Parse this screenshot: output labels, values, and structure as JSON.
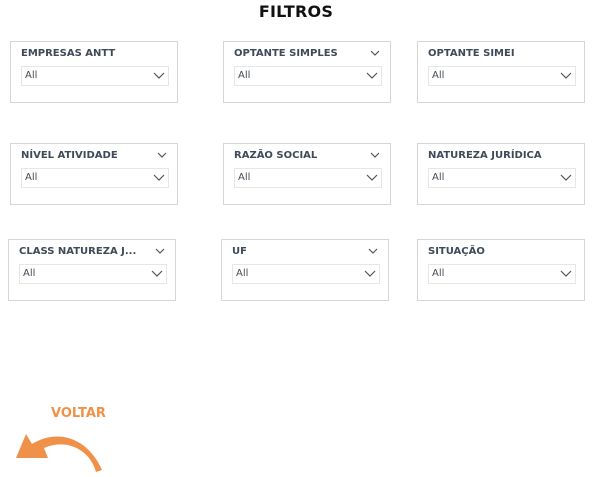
{
  "page": {
    "title": "FILTROS",
    "accent_color": "#f0914a"
  },
  "slicers": [
    {
      "title": "EMPRESAS ANTT",
      "value": "All",
      "header_chevron": false
    },
    {
      "title": "OPTANTE SIMPLES",
      "value": "All",
      "header_chevron": true
    },
    {
      "title": "OPTANTE SIMEI",
      "value": "All",
      "header_chevron": false
    },
    {
      "title": "NÍVEL ATIVIDADE",
      "value": "All",
      "header_chevron": true
    },
    {
      "title": "RAZÃO SOCIAL",
      "value": "All",
      "header_chevron": true
    },
    {
      "title": "NATUREZA JURÍDICA",
      "value": "All",
      "header_chevron": false
    },
    {
      "title": "CLASS NATUREZA J...",
      "value": "All",
      "header_chevron": true
    },
    {
      "title": "UF",
      "value": "All",
      "header_chevron": true
    },
    {
      "title": "SITUAÇÃO",
      "value": "All",
      "header_chevron": false
    }
  ],
  "back_button": {
    "label": "VOLTAR",
    "icon": "undo-arrow-icon"
  }
}
